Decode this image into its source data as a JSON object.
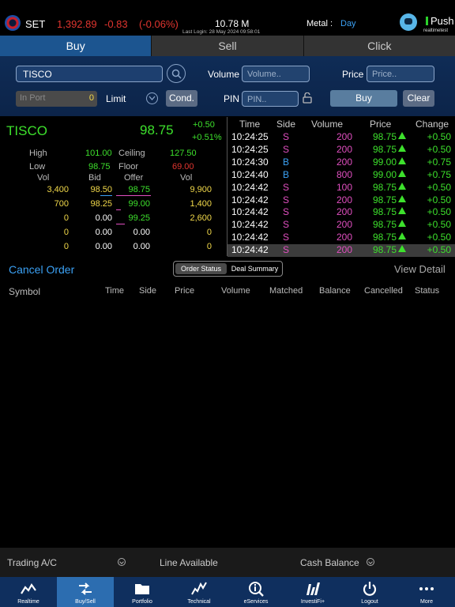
{
  "status": {
    "market": "SET",
    "index": "1,392.89",
    "change": "-0.83",
    "change_pct": "(-0.06%)",
    "volume": "10.78 M",
    "last_login": "Last Login: 28 May 2024 09:58:01",
    "metal_label": "Metal :",
    "metal_value": "Day",
    "push_label": "Push",
    "push_sub": "realtimetest"
  },
  "tabs": [
    {
      "label": "Buy",
      "active": true
    },
    {
      "label": "Sell",
      "active": false
    },
    {
      "label": "Click",
      "active": false
    }
  ],
  "order": {
    "symbol": "TISCO",
    "volume_label": "Volume",
    "volume_placeholder": "Volume..",
    "price_label": "Price",
    "price_placeholder": "Price..",
    "inport_label": "In Port",
    "inport_value": "0",
    "order_type": "Limit",
    "cond_label": "Cond.",
    "pin_label": "PIN",
    "pin_placeholder": "PIN..",
    "buy_label": "Buy",
    "clear_label": "Clear"
  },
  "quote": {
    "symbol": "TISCO",
    "last": "98.75",
    "change": "+0.50",
    "change_pct": "+0.51%",
    "high_label": "High",
    "high": "101.00",
    "ceiling_label": "Ceiling",
    "ceiling": "127.50",
    "low_label": "Low",
    "low": "98.75",
    "floor_label": "Floor",
    "floor": "69.00",
    "bidoffer_headers": [
      "Vol",
      "Bid",
      "Offer",
      "Vol"
    ],
    "bidoffer": [
      {
        "bid_vol": "3,400",
        "bid": "98.50",
        "offer": "98.75",
        "offer_vol": "9,900"
      },
      {
        "bid_vol": "700",
        "bid": "98.25",
        "offer": "99.00",
        "offer_vol": "1,400"
      },
      {
        "bid_vol": "0",
        "bid": "0.00",
        "offer": "99.25",
        "offer_vol": "2,600"
      },
      {
        "bid_vol": "0",
        "bid": "0.00",
        "offer": "0.00",
        "offer_vol": "0"
      },
      {
        "bid_vol": "0",
        "bid": "0.00",
        "offer": "0.00",
        "offer_vol": "0"
      }
    ]
  },
  "ticker": {
    "headers": [
      "Time",
      "Side",
      "Volume",
      "Price",
      "Change"
    ],
    "rows": [
      {
        "time": "10:24:25",
        "side": "S",
        "volume": "200",
        "price": "98.75",
        "change": "+0.50"
      },
      {
        "time": "10:24:25",
        "side": "S",
        "volume": "200",
        "price": "98.75",
        "change": "+0.50"
      },
      {
        "time": "10:24:30",
        "side": "B",
        "volume": "200",
        "price": "99.00",
        "change": "+0.75"
      },
      {
        "time": "10:24:40",
        "side": "B",
        "volume": "800",
        "price": "99.00",
        "change": "+0.75"
      },
      {
        "time": "10:24:42",
        "side": "S",
        "volume": "100",
        "price": "98.75",
        "change": "+0.50"
      },
      {
        "time": "10:24:42",
        "side": "S",
        "volume": "200",
        "price": "98.75",
        "change": "+0.50"
      },
      {
        "time": "10:24:42",
        "side": "S",
        "volume": "200",
        "price": "98.75",
        "change": "+0.50"
      },
      {
        "time": "10:24:42",
        "side": "S",
        "volume": "200",
        "price": "98.75",
        "change": "+0.50"
      },
      {
        "time": "10:24:42",
        "side": "S",
        "volume": "200",
        "price": "98.75",
        "change": "+0.50"
      },
      {
        "time": "10:24:42",
        "side": "S",
        "volume": "200",
        "price": "98.75",
        "change": "+0.50"
      }
    ]
  },
  "orders": {
    "cancel_label": "Cancel Order",
    "seg_order_status": "Order Status",
    "seg_deal_summary": "Deal Summary",
    "view_detail": "View Detail",
    "headers": [
      "Symbol",
      "Time",
      "Side",
      "Price",
      "Volume",
      "Matched",
      "Balance",
      "Cancelled",
      "Status"
    ]
  },
  "account": {
    "trading_label": "Trading A/C",
    "line_label": "Line Available",
    "cash_label": "Cash Balance"
  },
  "nav": [
    {
      "label": "Realtime",
      "icon": "realtime-chart-icon",
      "active": false
    },
    {
      "label": "Buy/Sell",
      "icon": "buy-sell-arrows-icon",
      "active": true
    },
    {
      "label": "Portfolio",
      "icon": "folder-icon",
      "active": false
    },
    {
      "label": "Technical",
      "icon": "technical-chart-icon",
      "active": false
    },
    {
      "label": "eServices",
      "icon": "magnifier-info-icon",
      "active": false
    },
    {
      "label": "InvestiFi+",
      "icon": "investifi-icon",
      "active": false
    },
    {
      "label": "Logout",
      "icon": "power-icon",
      "active": false
    },
    {
      "label": "More",
      "icon": "more-dots-icon",
      "active": false
    }
  ],
  "colors": {
    "up": "#3de02c",
    "down": "#e0352f",
    "neutral": "#f2d94a",
    "accent": "#3ba1f4",
    "sell": "#e14fc0",
    "buy": "#3ba1f4"
  }
}
